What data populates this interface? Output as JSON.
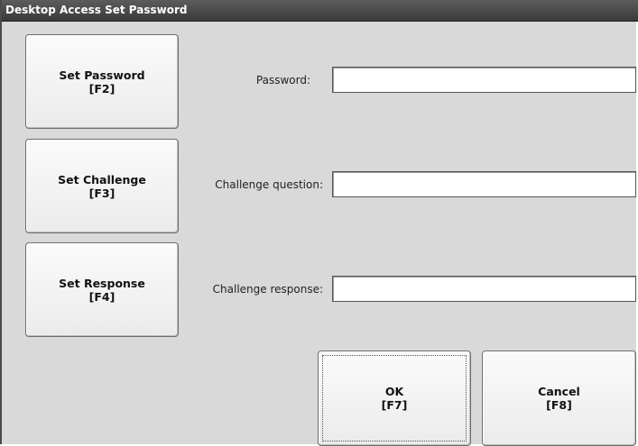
{
  "window": {
    "title": "Desktop Access Set Password"
  },
  "side_buttons": [
    {
      "label": "Set Password",
      "key": "[F2]"
    },
    {
      "label": "Set Challenge",
      "key": "[F3]"
    },
    {
      "label": "Set Response",
      "key": "[F4]"
    }
  ],
  "fields": [
    {
      "label": "Password:",
      "value": ""
    },
    {
      "label": "Challenge question:",
      "value": ""
    },
    {
      "label": "Challenge response:",
      "value": ""
    }
  ],
  "actions": {
    "ok": {
      "label": "OK",
      "key": "[F7]"
    },
    "cancel": {
      "label": "Cancel",
      "key": "[F8]"
    }
  }
}
